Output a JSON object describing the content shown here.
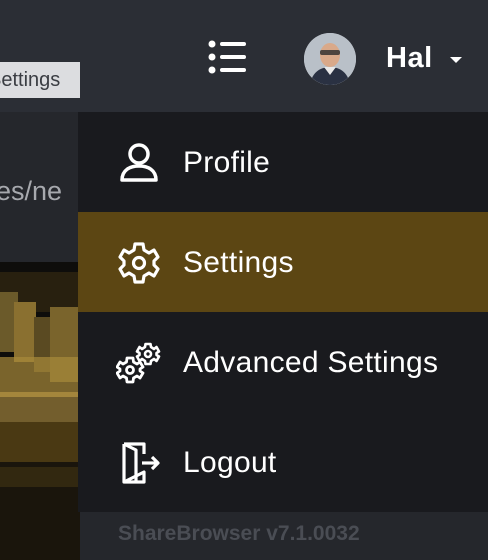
{
  "header": {
    "username": "Hal",
    "list_icon": "list-icon",
    "caret_icon": "caret-down-icon",
    "avatar_icon": "user-avatar-photo"
  },
  "tooltip": {
    "text": "Settings"
  },
  "background": {
    "path_text": "es/ne"
  },
  "menu": {
    "items": [
      {
        "label": "Profile",
        "icon": "user-icon",
        "active": false
      },
      {
        "label": "Settings",
        "icon": "gear-icon",
        "active": true
      },
      {
        "label": "Advanced Settings",
        "icon": "gears-icon",
        "active": false
      },
      {
        "label": "Logout",
        "icon": "logout-icon",
        "active": false
      }
    ]
  },
  "footer": {
    "version": "ShareBrowser v7.1.0032"
  },
  "colors": {
    "topbar": "#2b2e35",
    "menu_bg": "#191a1e",
    "active_item": "#5c4613",
    "page_bg": "#25272c"
  }
}
